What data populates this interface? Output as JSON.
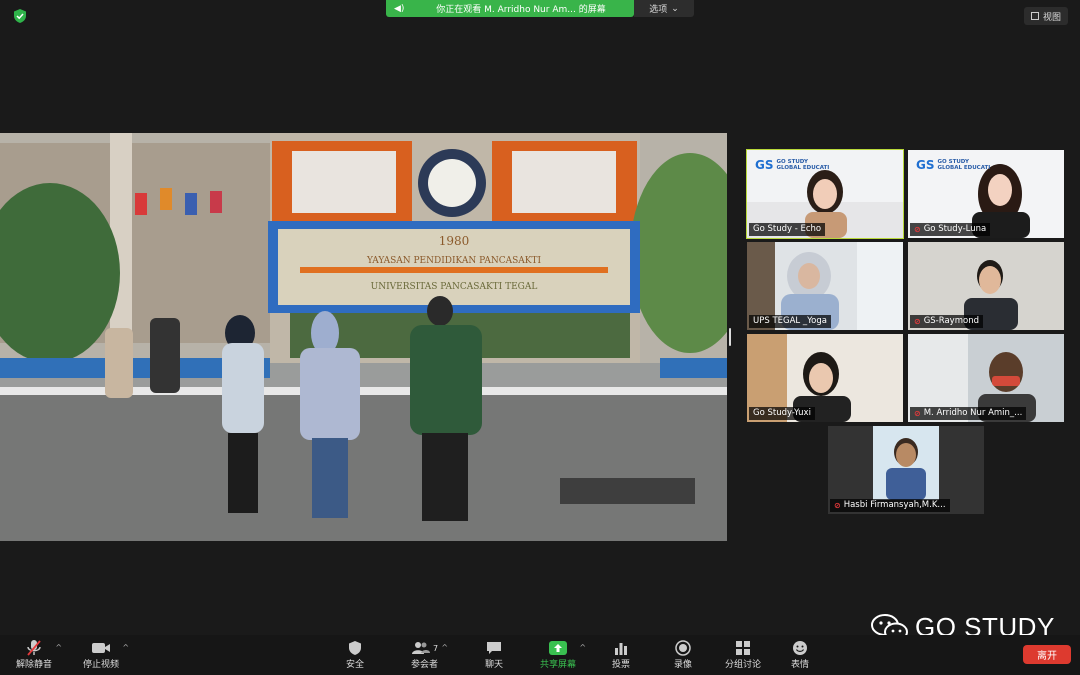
{
  "top": {
    "share_banner": "你正在观看 M. Arridho Nur Am... 的屏幕",
    "options_label": "选项",
    "view_label": "视图"
  },
  "shared_screen": {
    "sign_year": "1980",
    "sign_line1": "YAYASAN PENDIDIKAN PANCASAKTI",
    "sign_line2": "UNIVERSITAS PANCASAKTI TEGAL"
  },
  "participants": [
    {
      "name": "Go Study - Echo",
      "muted": false,
      "active": true
    },
    {
      "name": "Go Study-Luna",
      "muted": true,
      "active": false
    },
    {
      "name": "UPS TEGAL _Yoga",
      "muted": false,
      "active": false
    },
    {
      "name": "GS-Raymond",
      "muted": true,
      "active": false
    },
    {
      "name": "Go Study-Yuxi",
      "muted": false,
      "active": false
    },
    {
      "name": "M. Arridho Nur Amin_...",
      "muted": true,
      "active": false
    },
    {
      "name": "Hasbi Firmansyah,M.K...",
      "muted": true,
      "active": false
    }
  ],
  "logo": {
    "mark": "GS",
    "line1": "GO STUDY",
    "line2": "GLOBAL EDUCATI"
  },
  "toolbar": {
    "unmute": "解除静音",
    "stop_video": "停止视频",
    "security": "安全",
    "participants": "参会者",
    "participant_count": "7",
    "chat": "聊天",
    "share_screen": "共享屏幕",
    "polls": "投票",
    "record": "录像",
    "breakout": "分组讨论",
    "reactions": "表情",
    "leave": "离开"
  },
  "watermark": "GO STUDY",
  "colors": {
    "share_green": "#39b44a",
    "leave_red": "#dd3a2f",
    "active_border": "#b9d93a"
  }
}
